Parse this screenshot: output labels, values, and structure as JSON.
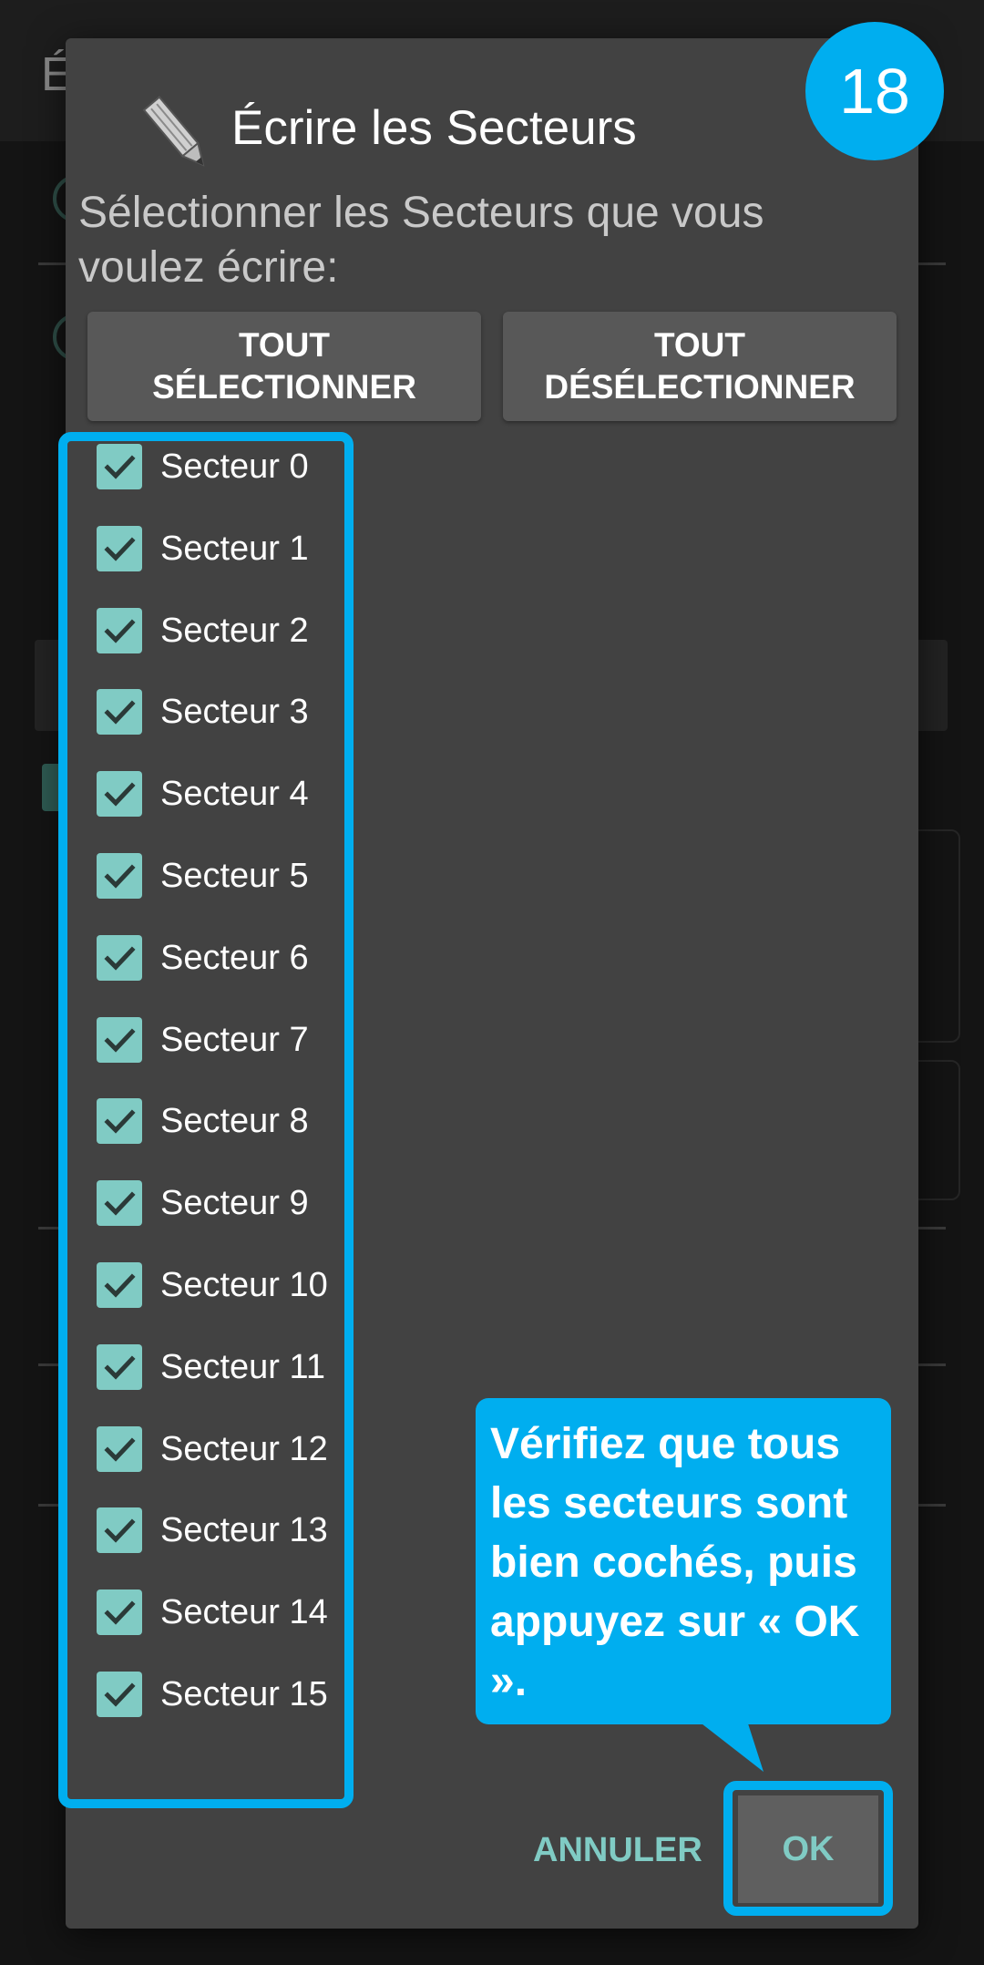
{
  "step": {
    "number": "18"
  },
  "background": {
    "title_fragment": "É"
  },
  "dialog": {
    "title": "Écrire les Secteurs",
    "message": "Sélectionner les Secteurs que vous voulez écrire:",
    "select_all": {
      "line1": "TOUT",
      "line2": "SÉLECTIONNER"
    },
    "deselect_all": {
      "line1": "TOUT",
      "line2": "DÉSÉLECTIONNER"
    },
    "sectors": [
      {
        "label": "Secteur 0",
        "checked": true
      },
      {
        "label": "Secteur 1",
        "checked": true
      },
      {
        "label": "Secteur 2",
        "checked": true
      },
      {
        "label": "Secteur 3",
        "checked": true
      },
      {
        "label": "Secteur 4",
        "checked": true
      },
      {
        "label": "Secteur 5",
        "checked": true
      },
      {
        "label": "Secteur 6",
        "checked": true
      },
      {
        "label": "Secteur 7",
        "checked": true
      },
      {
        "label": "Secteur 8",
        "checked": true
      },
      {
        "label": "Secteur 9",
        "checked": true
      },
      {
        "label": "Secteur 10",
        "checked": true
      },
      {
        "label": "Secteur 11",
        "checked": true
      },
      {
        "label": "Secteur 12",
        "checked": true
      },
      {
        "label": "Secteur 13",
        "checked": true
      },
      {
        "label": "Secteur 14",
        "checked": true
      },
      {
        "label": "Secteur 15",
        "checked": true
      }
    ],
    "cancel_label": "ANNULER",
    "ok_label": "OK"
  },
  "callout": {
    "text": "Vérifiez que tous les secteurs sont bien cochés, puis appuyez sur « OK »."
  },
  "colors": {
    "accent_teal": "#80cbc4",
    "annotation_blue": "#00aeef",
    "dialog_bg": "#424242"
  },
  "icons": {
    "dialog": "pencil-icon",
    "checkbox": "check-icon"
  }
}
